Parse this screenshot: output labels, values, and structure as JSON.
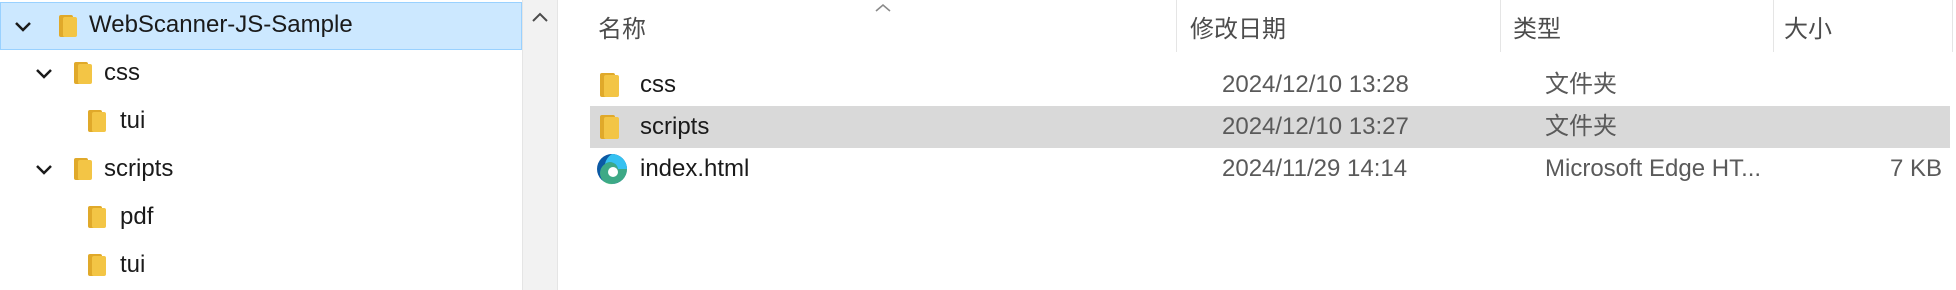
{
  "tree": {
    "items": [
      {
        "label": "WebScanner-JS-Sample"
      },
      {
        "label": "css"
      },
      {
        "label": "tui"
      },
      {
        "label": "scripts"
      },
      {
        "label": "pdf"
      },
      {
        "label": "tui"
      }
    ]
  },
  "list": {
    "headers": {
      "name": "名称",
      "modified": "修改日期",
      "type": "类型",
      "size": "大小"
    },
    "rows": [
      {
        "name": "css",
        "modified": "2024/12/10 13:28",
        "type": "文件夹",
        "size": ""
      },
      {
        "name": "scripts",
        "modified": "2024/12/10 13:27",
        "type": "文件夹",
        "size": ""
      },
      {
        "name": "index.html",
        "modified": "2024/11/29 14:14",
        "type": "Microsoft Edge HT...",
        "size": "7 KB"
      }
    ]
  },
  "icons": {
    "folder": "folder-icon",
    "edge": "edge-browser-icon",
    "chevron": "chevron-down-icon",
    "scroll_up": "chevron-up-icon"
  },
  "colors": {
    "tree_selected_bg": "#cce8ff",
    "tree_selected_border": "#99d1ff",
    "row_selected_bg": "#d9d9d9",
    "folder": "#f3c545"
  }
}
